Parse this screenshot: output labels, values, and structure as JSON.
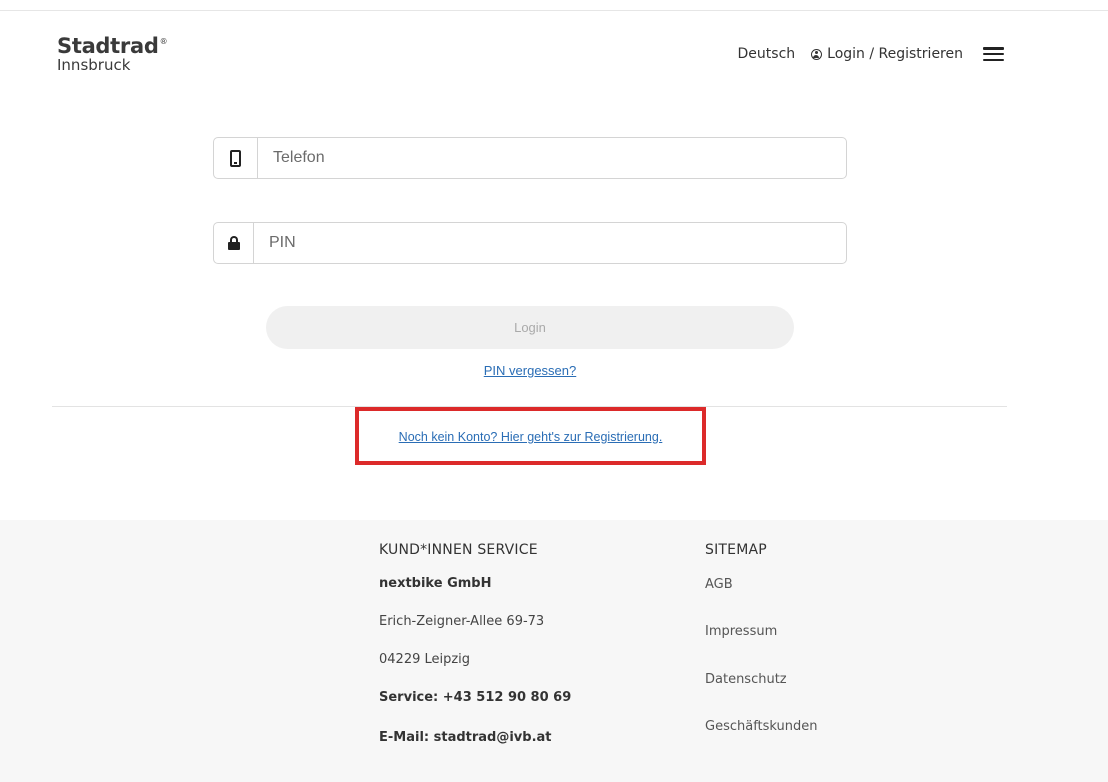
{
  "header": {
    "logo_main": "Stadtrad",
    "logo_mark": "®",
    "logo_sub": "Innsbruck",
    "language": "Deutsch",
    "login_label": "Login / Registrieren"
  },
  "form": {
    "phone_placeholder": "Telefon",
    "pin_placeholder": "PIN",
    "login_button": "Login",
    "forgot_pin": "PIN vergessen?",
    "register_link": "Noch kein Konto? Hier geht's zur Registrierung."
  },
  "footer": {
    "service": {
      "heading": "KUND*INNEN SERVICE",
      "company": "nextbike GmbH",
      "street": "Erich-Zeigner-Allee 69-73",
      "city": "04229 Leipzig",
      "phone": "Service: +43 512 90 80 69",
      "email": "E-Mail: stadtrad@ivb.at"
    },
    "sitemap": {
      "heading": "SITEMAP",
      "links": [
        "AGB",
        "Impressum",
        "Datenschutz",
        "Geschäftskunden"
      ]
    }
  },
  "colors": {
    "link": "#2a6db5",
    "highlight_border": "#dc2a2a",
    "footer_bg": "#f7f7f7",
    "button_disabled_bg": "#f0f0f0"
  },
  "icons": [
    "user-circle-icon",
    "hamburger-menu-icon",
    "phone-icon",
    "lock-icon"
  ]
}
